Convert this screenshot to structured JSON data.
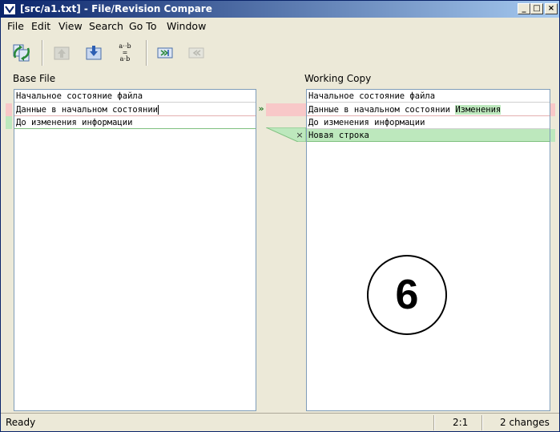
{
  "window": {
    "title": "[src/a1.txt] - File/Revision Compare",
    "minimize": "_",
    "maximize": "□",
    "close": "×"
  },
  "menu": {
    "items": [
      {
        "label": "File"
      },
      {
        "label": "Edit"
      },
      {
        "label": "View"
      },
      {
        "label": "Search"
      },
      {
        "label": "Go To"
      },
      {
        "label": "Window"
      }
    ]
  },
  "toolbar": {
    "buttons": [
      {
        "icon": "refresh-compare-icon"
      },
      {
        "icon": "previous-difference-icon"
      },
      {
        "icon": "next-difference-icon"
      },
      {
        "icon": "ignore-whitespace-icon",
        "top_text": "a⋅⋅b",
        "eq": "=",
        "bottom_text": "a⋅b"
      },
      {
        "icon": "copy-to-right-icon"
      },
      {
        "icon": "copy-to-left-icon"
      }
    ]
  },
  "base": {
    "header": "Base File",
    "lines": [
      "Начальное состояние файла",
      "Данные в начальном состоянии",
      "До изменения информации"
    ]
  },
  "working": {
    "header": "Working Copy",
    "lines": [
      "Начальное состояние файла",
      "Данные в начальном состоянии",
      "До изменения информации",
      "Новая строка"
    ],
    "changed_word": "Изменения"
  },
  "gutter": {
    "copy_glyph": "»",
    "delete_glyph": "×"
  },
  "status": {
    "state": "Ready",
    "position": "2:1",
    "changes": "2 changes"
  },
  "annotation": {
    "step": "6"
  },
  "colors": {
    "changed": "#f8c8c8",
    "added": "#bde8bd",
    "title_start": "#0a246a",
    "title_end": "#a6caf0"
  }
}
